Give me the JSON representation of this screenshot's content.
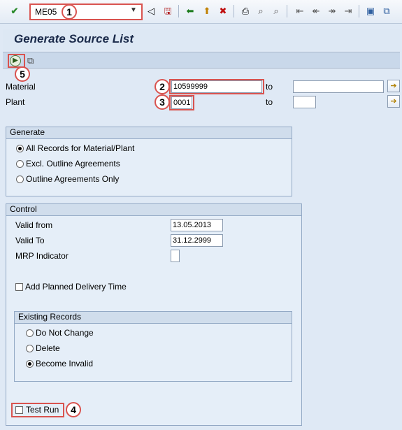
{
  "toolbar": {
    "command_value": "ME05",
    "icons": [
      "enter-icon",
      "back-icon",
      "save-icon",
      "back-green-icon",
      "exit-icon",
      "cancel-icon",
      "print-icon",
      "find-icon",
      "find-next-icon",
      "first-page-icon",
      "prev-page-icon",
      "next-page-icon",
      "last-page-icon",
      "create-session-icon",
      "shortcut-icon"
    ]
  },
  "title": "Generate Source List",
  "callouts": {
    "c1": "1",
    "c2": "2",
    "c3": "3",
    "c4": "4",
    "c5": "5"
  },
  "selection": {
    "material_label": "Material",
    "material_value": "10599999",
    "plant_label": "Plant",
    "plant_value": "0001",
    "to_label": "to",
    "to_label2": "to"
  },
  "generate": {
    "title": "Generate",
    "options": [
      "All Records for Material/Plant",
      "Excl. Outline Agreements",
      "Outline Agreements Only"
    ],
    "selected": 0
  },
  "control": {
    "title": "Control",
    "valid_from_label": "Valid from",
    "valid_from_value": "13.05.2013",
    "valid_to_label": "Valid To",
    "valid_to_value": "31.12.2999",
    "mrp_label": "MRP Indicator",
    "add_planned_label": "Add Planned Delivery Time",
    "existing_title": "Existing Records",
    "existing_options": [
      "Do Not Change",
      "Delete",
      "Become Invalid"
    ],
    "existing_selected": 2,
    "test_run_label": "Test Run"
  }
}
